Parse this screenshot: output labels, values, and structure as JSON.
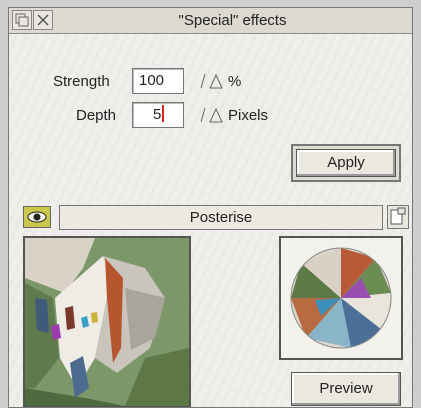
{
  "window": {
    "title": "\"Special\" effects"
  },
  "params": {
    "strength": {
      "label": "Strength",
      "value": "100",
      "unit": "%"
    },
    "depth": {
      "label": "Depth",
      "value": "5",
      "unit": "Pixels"
    }
  },
  "buttons": {
    "apply": "Apply",
    "preview": "Preview"
  },
  "effect": {
    "selected": "Posterise"
  },
  "icons": {
    "back": "back-icon",
    "close": "close-icon",
    "eye": "eye-icon",
    "menu": "menu-icon",
    "adjuster": "adjuster-arrows-icon"
  },
  "colors": {
    "eye_button": "#c9c84a",
    "caret": "#d22222"
  }
}
